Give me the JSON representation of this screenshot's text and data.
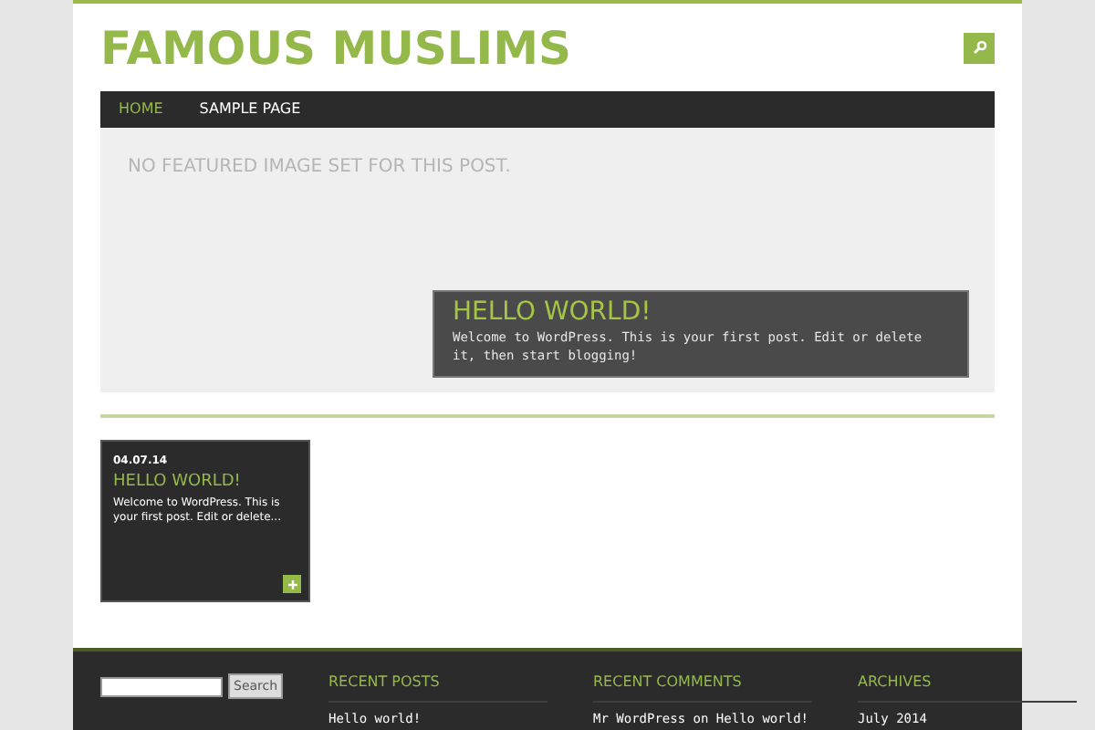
{
  "site_title": "FAMOUS MUSLIMS",
  "nav": [
    {
      "label": "HOME",
      "selected": true
    },
    {
      "label": "SAMPLE PAGE",
      "selected": false
    }
  ],
  "featured": {
    "notice": "NO FEATURED IMAGE SET FOR THIS POST.",
    "title": "HELLO WORLD!",
    "excerpt": "Welcome to WordPress. This is your first post. Edit or delete it, then start blogging!"
  },
  "posts": [
    {
      "date": "04.07.14",
      "title": "HELLO WORLD!",
      "excerpt": "Welcome to WordPress. This is your first post. Edit or delete..."
    }
  ],
  "footer": {
    "search_button": "Search",
    "widgets": [
      {
        "title": "RECENT POSTS",
        "items": [
          "Hello world!"
        ]
      },
      {
        "title": "RECENT COMMENTS",
        "items": [
          "Mr WordPress on Hello world!"
        ]
      },
      {
        "title": "ARCHIVES",
        "items": [
          "July 2014"
        ]
      }
    ]
  }
}
